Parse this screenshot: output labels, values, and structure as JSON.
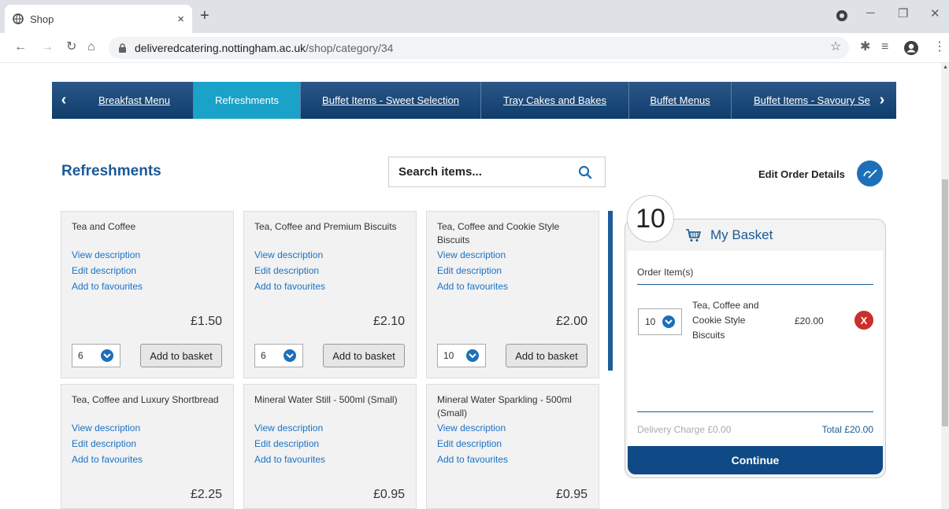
{
  "browser": {
    "tab_title": "Shop",
    "tab_close": "×",
    "new_tab": "+",
    "url_host": "deliveredcatering.nottingham.ac.uk",
    "url_path": "/shop/category/34"
  },
  "nav": {
    "prev": "‹",
    "next": "›",
    "items": [
      {
        "label": "Breakfast Menu",
        "active": false
      },
      {
        "label": "Refreshments",
        "active": true
      },
      {
        "label": "Buffet Items - Sweet Selection",
        "active": false
      },
      {
        "label": "Tray Cakes and Bakes",
        "active": false
      },
      {
        "label": "Buffet Menus",
        "active": false
      },
      {
        "label": "Buffet Items - Savoury Se",
        "active": false
      }
    ]
  },
  "page": {
    "heading": "Refreshments",
    "search_placeholder": "Search items...",
    "edit_order_label": "Edit Order Details"
  },
  "products": [
    {
      "name": "Tea and Coffee",
      "view": "View description",
      "edit": "Edit description",
      "fav": "Add to favourites",
      "price": "£1.50",
      "qty": "6",
      "add": "Add to basket"
    },
    {
      "name": "Tea, Coffee and Premium Biscuits",
      "view": "View description",
      "edit": "Edit description",
      "fav": "Add to favourites",
      "price": "£2.10",
      "qty": "6",
      "add": "Add to basket"
    },
    {
      "name": "Tea, Coffee and Cookie Style Biscuits",
      "view": "View description",
      "edit": "Edit description",
      "fav": "Add to favourites",
      "price": "£2.00",
      "qty": "10",
      "add": "Add to basket"
    },
    {
      "name": "Tea, Coffee and Luxury Shortbread",
      "view": "View description",
      "edit": "Edit description",
      "fav": "Add to favourites",
      "price": "£2.25"
    },
    {
      "name": "Mineral Water Still - 500ml (Small)",
      "view": "View description",
      "edit": "Edit description",
      "fav": "Add to favourites",
      "price": "£0.95"
    },
    {
      "name": "Mineral Water Sparkling - 500ml (Small)",
      "view": "View description",
      "edit": "Edit description",
      "fav": "Add to favourites",
      "price": "£0.95"
    }
  ],
  "basket": {
    "count": "10",
    "title": "My Basket",
    "order_items_label": "Order Item(s)",
    "item": {
      "qty": "10",
      "name": "Tea, Coffee and Cookie Style Biscuits",
      "price": "£20.00",
      "remove": "X"
    },
    "delivery": "Delivery Charge £0.00",
    "total": "Total £20.00",
    "continue": "Continue"
  }
}
